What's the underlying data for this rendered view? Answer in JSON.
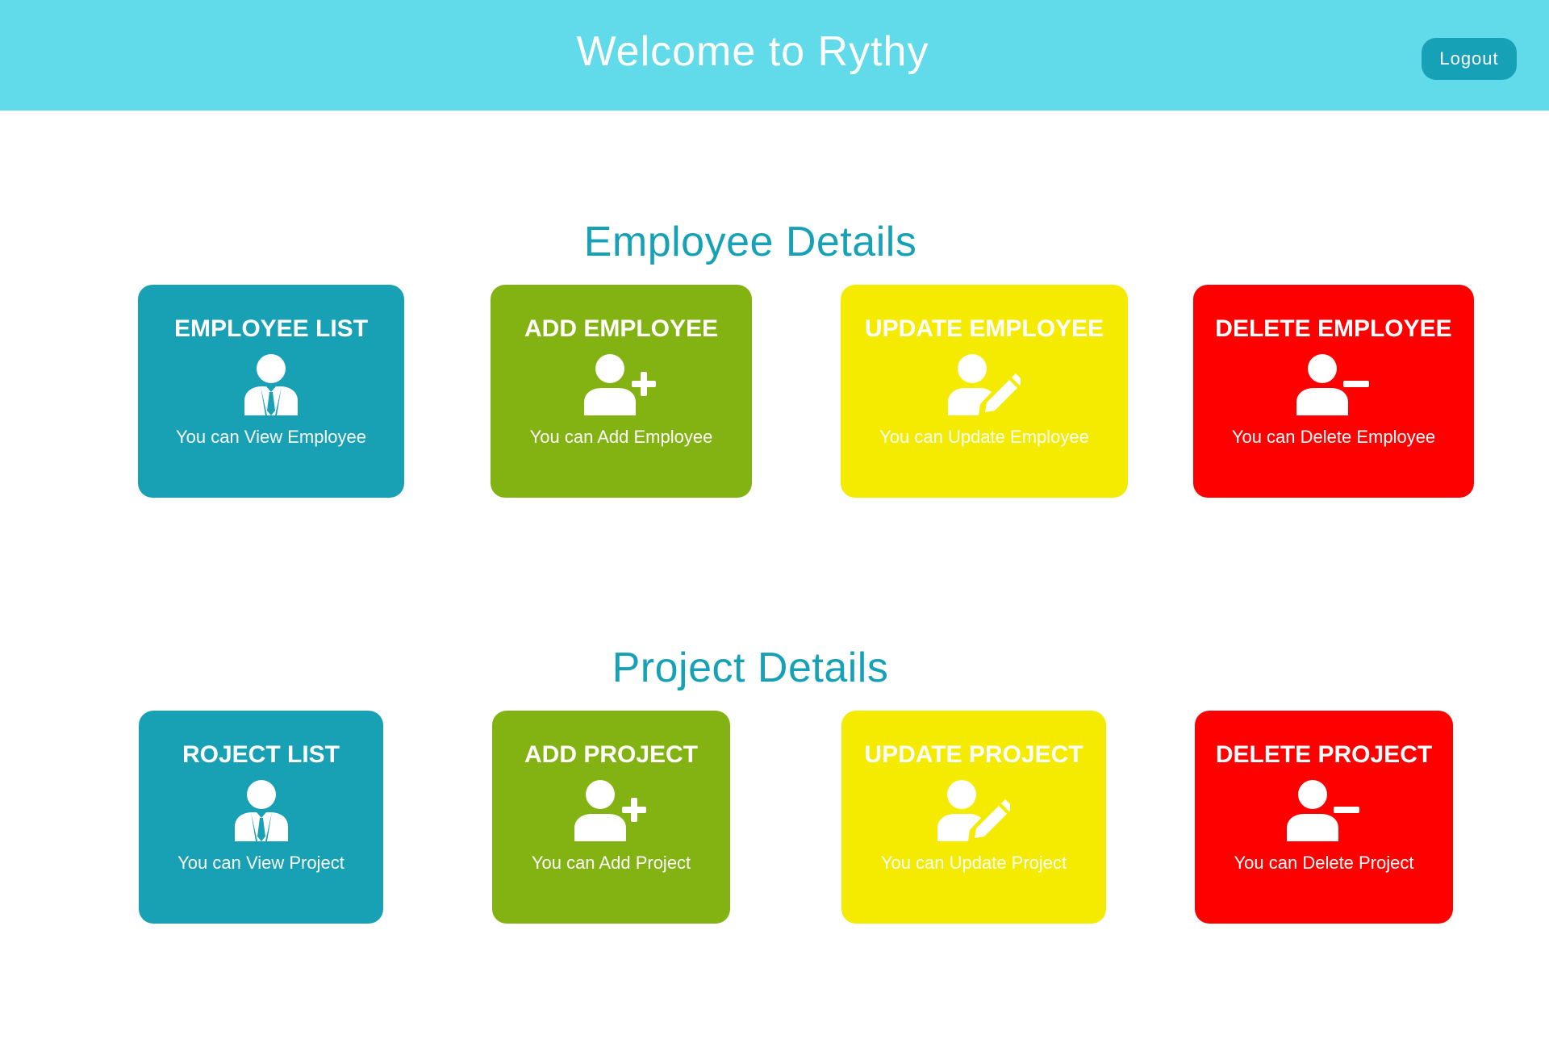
{
  "header": {
    "title": "Welcome to Rythy",
    "logout_label": "Logout"
  },
  "colors": {
    "header_bg": "#61dbea",
    "accent": "#17a1b6",
    "teal": "#18a0b4",
    "green": "#82b312",
    "yellow": "#f5eb00",
    "red": "#ff0000"
  },
  "employee_section": {
    "title": "Employee Details",
    "cards": [
      {
        "title": "EMPLOYEE LIST",
        "desc": "You can View Employee",
        "icon": "user-tie-icon",
        "color": "teal"
      },
      {
        "title": "ADD EMPLOYEE",
        "desc": "You can Add Employee",
        "icon": "user-plus-icon",
        "color": "green"
      },
      {
        "title": "UPDATE EMPLOYEE",
        "desc": "You can Update Employee",
        "icon": "user-edit-icon",
        "color": "yellow"
      },
      {
        "title": "DELETE EMPLOYEE",
        "desc": "You can Delete Employee",
        "icon": "user-minus-icon",
        "color": "red"
      }
    ]
  },
  "project_section": {
    "title": "Project Details",
    "cards": [
      {
        "title": "ROJECT LIST",
        "desc": "You can View Project",
        "icon": "user-tie-icon",
        "color": "teal"
      },
      {
        "title": "ADD PROJECT",
        "desc": "You can Add Project",
        "icon": "user-plus-icon",
        "color": "green"
      },
      {
        "title": "UPDATE PROJECT",
        "desc": "You can Update Project",
        "icon": "user-edit-icon",
        "color": "yellow"
      },
      {
        "title": "DELETE PROJECT",
        "desc": "You can Delete Project",
        "icon": "user-minus-icon",
        "color": "red"
      }
    ]
  }
}
